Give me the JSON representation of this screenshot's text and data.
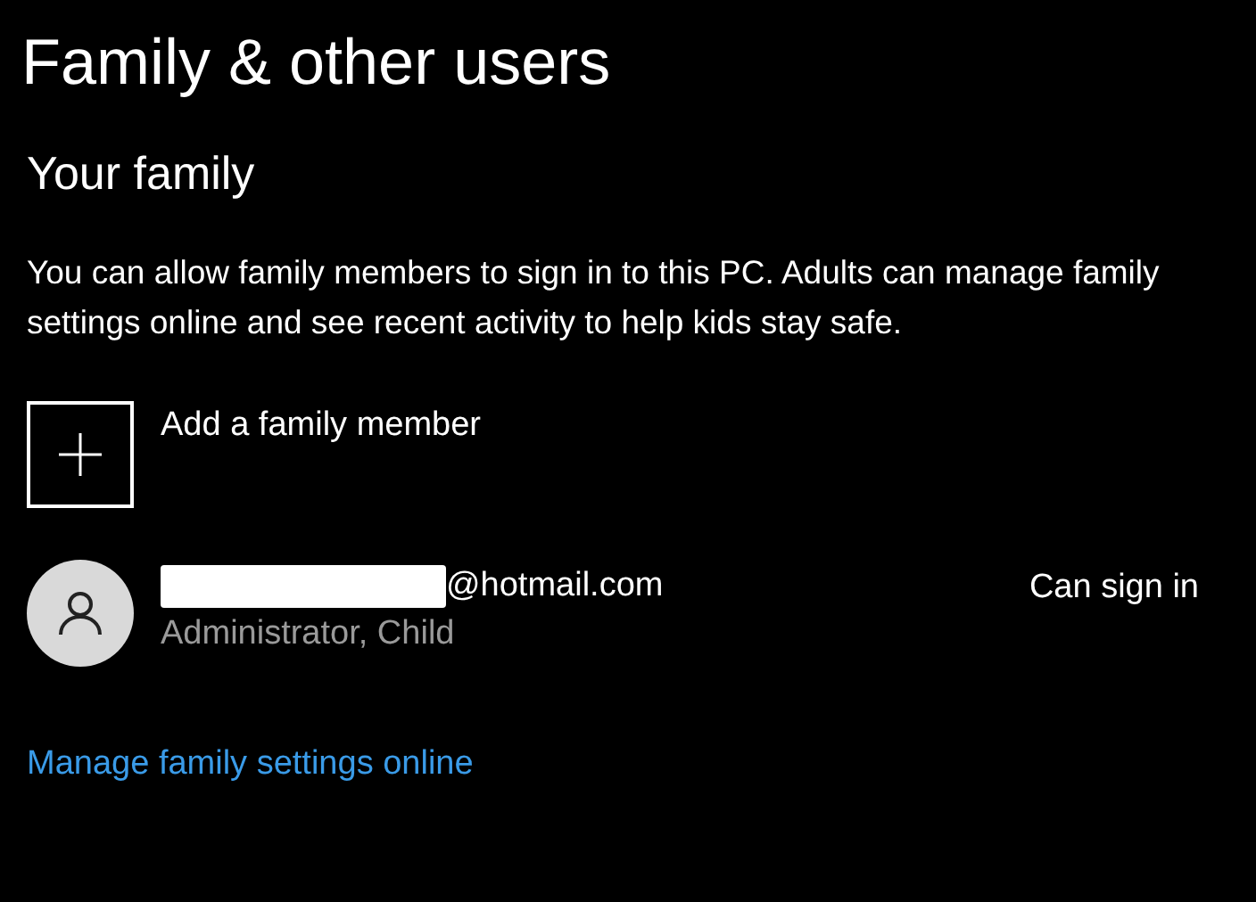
{
  "title": "Family & other users",
  "section": {
    "heading": "Your family",
    "description": "You can allow family members to sign in to this PC. Adults can manage family settings online and see recent activity to help kids stay safe.",
    "add_button": {
      "label": "Add a family member"
    },
    "members": [
      {
        "email": "@hotmail.com",
        "redacted": true,
        "role": "Administrator, Child",
        "status": "Can sign in"
      }
    ],
    "link": "Manage family settings online"
  }
}
